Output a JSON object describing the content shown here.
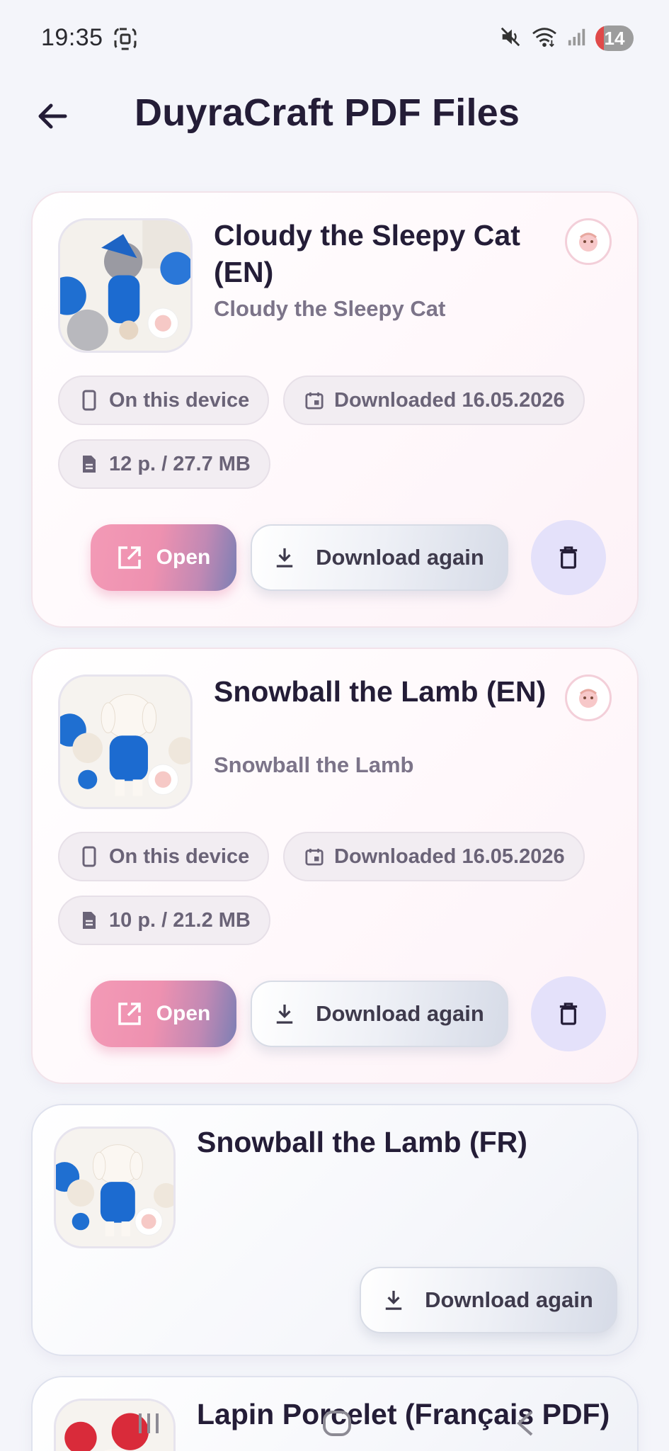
{
  "status_bar": {
    "time": "19:35",
    "battery": "14",
    "icons": [
      "screenshot-icon",
      "mute-icon",
      "wifi-icon",
      "signal-icon"
    ]
  },
  "header": {
    "title": "DuyraCraft PDF Files",
    "back_icon": "arrow-left-icon"
  },
  "cards": [
    {
      "title": "Cloudy the Sleepy Cat (EN)",
      "subtitle": "Cloudy the Sleepy Cat",
      "location": "On this device",
      "downloaded": "Downloaded 16.05.2026",
      "size": "12 p. / 27.7 MB",
      "open_label": "Open",
      "download_label": "Download again"
    },
    {
      "title": "Snowball the Lamb (EN)",
      "subtitle": "Snowball the Lamb",
      "location": "On this device",
      "downloaded": "Downloaded 16.05.2026",
      "size": "10 p. / 21.2 MB",
      "open_label": "Open",
      "download_label": "Download again"
    },
    {
      "title": "Snowball the Lamb (FR)",
      "download_label": "Download again"
    },
    {
      "title": "Lapin Porcelet (Français PDF)"
    }
  ],
  "colors": {
    "accent_pink": "#f39ab6",
    "accent_purple": "#7c7fb4",
    "delete_bg": "#e4e1fa",
    "title_text": "#241d37",
    "muted_text": "#7c7489"
  }
}
